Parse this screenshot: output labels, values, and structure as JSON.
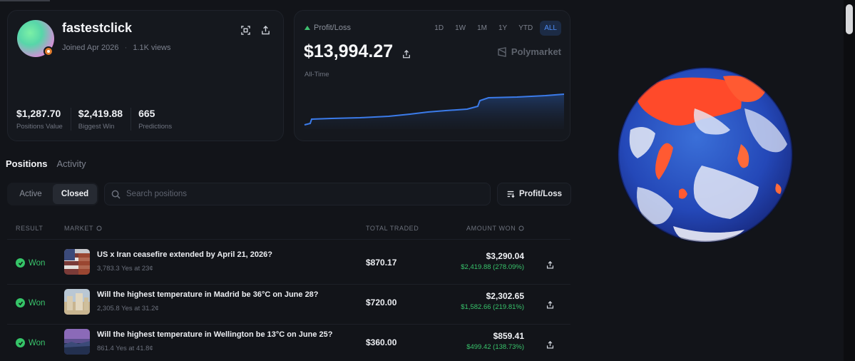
{
  "profile": {
    "username": "fastestclick",
    "joined": "Joined Apr 2026",
    "views": "1.1K views",
    "stats": [
      {
        "value": "$1,287.70",
        "label": "Positions Value"
      },
      {
        "value": "$2,419.88",
        "label": "Biggest Win"
      },
      {
        "value": "665",
        "label": "Predictions"
      }
    ]
  },
  "pnl": {
    "label": "Profit/Loss",
    "value": "$13,994.27",
    "period": "All-Time",
    "brand": "Polymarket",
    "ranges": [
      "1D",
      "1W",
      "1M",
      "1Y",
      "YTD",
      "ALL"
    ],
    "active_range": "ALL",
    "line_color": "#3b7bea",
    "accent_up": "#3fbf6f"
  },
  "tabs": {
    "positions": "Positions",
    "activity": "Activity"
  },
  "filters": {
    "active": "Active",
    "closed": "Closed",
    "search_placeholder": "Search positions",
    "sort_label": "Profit/Loss"
  },
  "table": {
    "headers": {
      "result": "RESULT",
      "market": "MARKET",
      "total_traded": "TOTAL TRADED",
      "amount_won": "AMOUNT WON"
    },
    "rows": [
      {
        "result": "Won",
        "question": "US x Iran ceasefire extended by April 21, 2026?",
        "sub": "3,783.3 Yes at 23¢",
        "traded": "$870.17",
        "amount": "$3,290.04",
        "gain": "$2,419.88 (278.09%)",
        "thumb": "flag"
      },
      {
        "result": "Won",
        "question": "Will the highest temperature in Madrid be 36°C on June 28?",
        "sub": "2,305.8 Yes at 31.2¢",
        "traded": "$720.00",
        "amount": "$2,302.65",
        "gain": "$1,582.66 (219.81%)",
        "thumb": "city"
      },
      {
        "result": "Won",
        "question": "Will the highest temperature in Wellington be 13°C on June 25?",
        "sub": "861.4 Yes at 41.8¢",
        "traded": "$360.00",
        "amount": "$859.41",
        "gain": "$499.42 (138.73%)",
        "thumb": "coast"
      }
    ]
  }
}
